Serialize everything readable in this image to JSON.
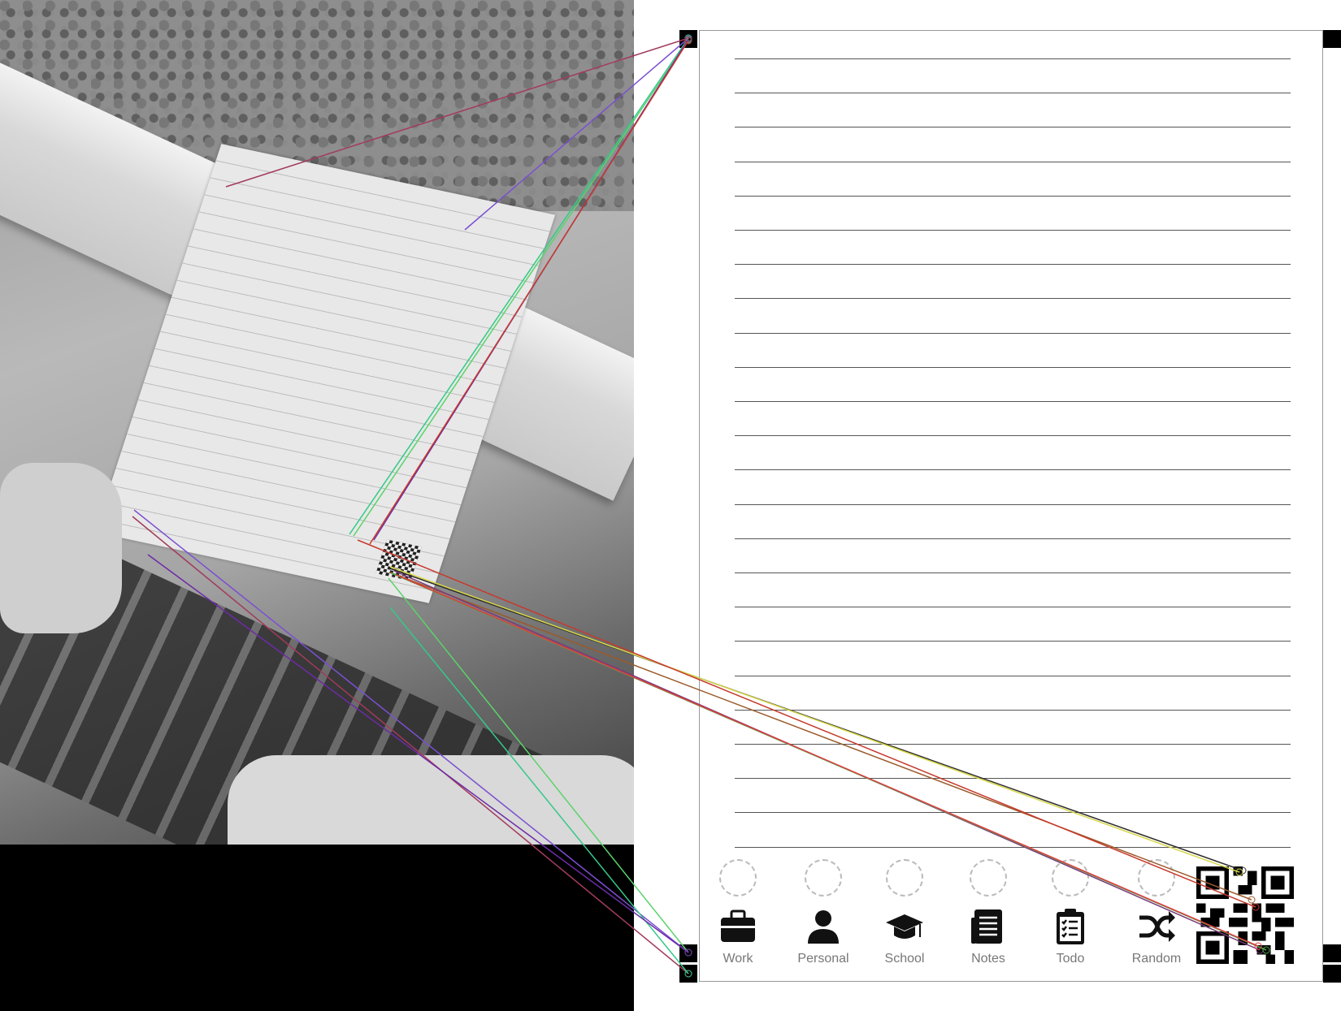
{
  "categories": [
    {
      "label": "Work",
      "icon": "briefcase-icon"
    },
    {
      "label": "Personal",
      "icon": "person-icon"
    },
    {
      "label": "School",
      "icon": "graduation-cap-icon"
    },
    {
      "label": "Notes",
      "icon": "newspaper-icon"
    },
    {
      "label": "Todo",
      "icon": "clipboard-icon"
    },
    {
      "label": "Random",
      "icon": "shuffle-icon"
    }
  ],
  "colors": {
    "match_lines": [
      "#a23b5c",
      "#7b4fd1",
      "#34c98a",
      "#5bd36a",
      "#6d2ba8",
      "#c63a2c",
      "#2b2b2b",
      "#9b5a2a",
      "#d6d64a",
      "#7a3a7a",
      "#4fa84f",
      "#e03c3c"
    ]
  }
}
